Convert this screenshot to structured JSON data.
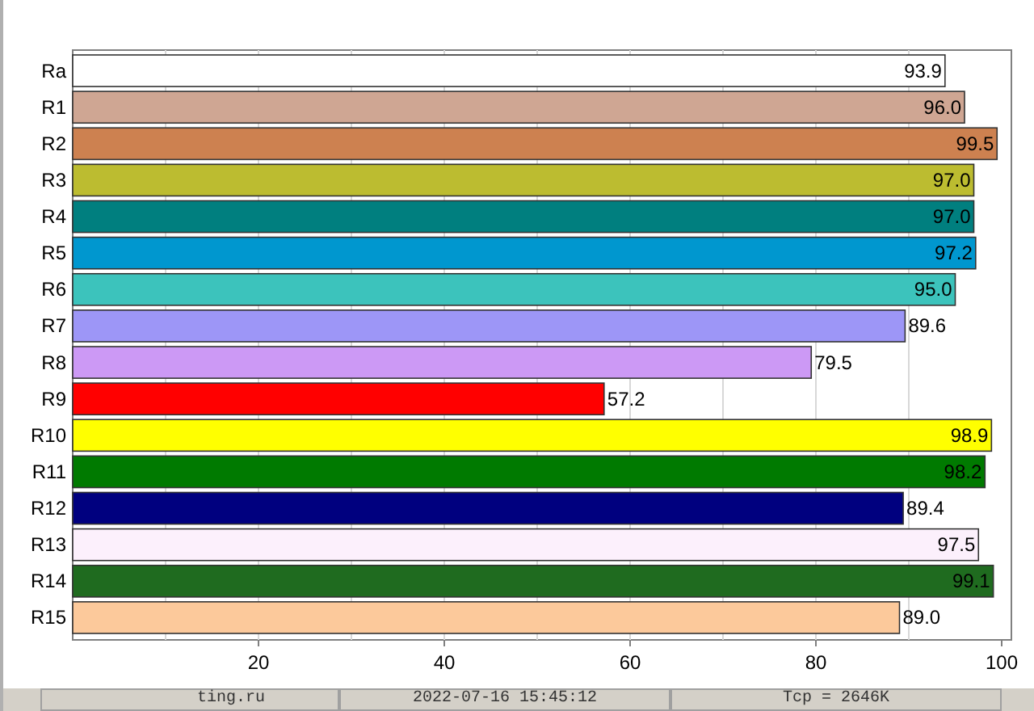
{
  "chart_data": {
    "type": "bar",
    "orientation": "horizontal",
    "categories": [
      "Ra",
      "R1",
      "R2",
      "R3",
      "R4",
      "R5",
      "R6",
      "R7",
      "R8",
      "R9",
      "R10",
      "R11",
      "R12",
      "R13",
      "R14",
      "R15"
    ],
    "series": [
      {
        "values": [
          93.9,
          96.0,
          99.5,
          97.0,
          97.0,
          97.2,
          95.0,
          89.6,
          79.5,
          57.2,
          98.9,
          98.2,
          89.4,
          97.5,
          99.1,
          89.0
        ]
      }
    ],
    "colors": [
      "#ffffff",
      "#cfa693",
      "#cd8150",
      "#bcbc30",
      "#007f7f",
      "#0097cf",
      "#3cc3bc",
      "#9d96f7",
      "#cc99f5",
      "#ff0000",
      "#ffff00",
      "#007a00",
      "#00007f",
      "#fcf0fc",
      "#1f6b1f",
      "#fcc99b"
    ],
    "value_labels": [
      "93.9",
      "96.0",
      "99.5",
      "97.0",
      "97.0",
      "97.2",
      "95.0",
      "89.6",
      "79.5",
      "57.2",
      "98.9",
      "98.2",
      "89.4",
      "97.5",
      "99.1",
      "89.0"
    ],
    "xlim": [
      0,
      100
    ],
    "xticks": [
      20,
      40,
      60,
      80,
      100
    ],
    "grid": true
  },
  "status_bar": [
    "ting.ru",
    "2022-07-16 15:45:12",
    "Tcp = 2646K"
  ]
}
